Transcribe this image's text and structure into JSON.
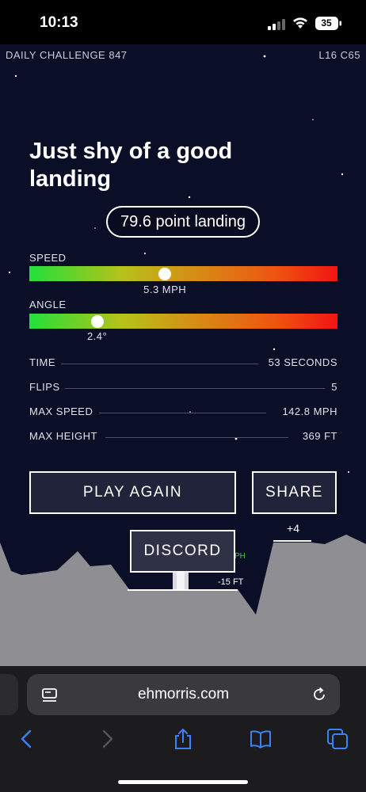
{
  "status_bar": {
    "time": "10:13",
    "battery": "35"
  },
  "hud": {
    "challenge": "DAILY CHALLENGE 847",
    "level": "L16 C65"
  },
  "result": {
    "title": "Just shy of a good landing",
    "score": "79.6 point landing"
  },
  "meters": {
    "speed": {
      "label": "SPEED",
      "value": "5.3 MPH",
      "level": 0.44
    },
    "angle": {
      "label": "ANGLE",
      "value": "2.4°",
      "level": 0.22
    }
  },
  "stats": [
    {
      "label": "TIME",
      "value": "53 SECONDS"
    },
    {
      "label": "FLIPS",
      "value": "5"
    },
    {
      "label": "MAX SPEED",
      "value": "142.8 MPH"
    },
    {
      "label": "MAX HEIGHT",
      "value": "369 FT"
    }
  ],
  "buttons": {
    "play_again": "PLAY AGAIN",
    "share": "SHARE",
    "discord": "DISCORD"
  },
  "scene": {
    "bonus": "+4",
    "depth": "-15 FT",
    "speed_partial": "PH"
  },
  "browser": {
    "url": "ehmorris.com"
  },
  "colors": {
    "background": "#0b0e27",
    "terrain": "#8e8e93",
    "meter_start": "#22e03a",
    "meter_end": "#f21412",
    "browser_chrome": "#1c1c1e",
    "toolbar_accent": "#3b82f6"
  },
  "icons": {
    "signal": "cellular-signal-icon",
    "wifi": "wifi-icon",
    "battery": "battery-icon",
    "tab": "tab-overview-icon",
    "reload": "reload-icon",
    "back": "back-chevron-icon",
    "forward": "forward-chevron-icon",
    "share": "share-icon",
    "bookmarks": "bookmarks-icon",
    "tabs": "tabs-icon"
  }
}
